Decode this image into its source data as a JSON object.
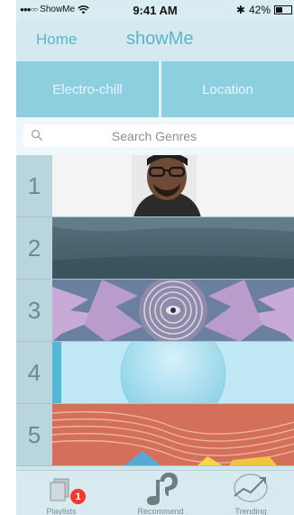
{
  "status_bar": {
    "carrier": "ShowMe",
    "time": "9:41 AM",
    "battery": "42%",
    "battery_level": 0.42
  },
  "nav": {
    "home_label": "Home",
    "title": "showMe"
  },
  "filters": {
    "genre": "Electro-chill",
    "location": "Location"
  },
  "search": {
    "placeholder": "Search Genres"
  },
  "playlist_rows": [
    {
      "rank": "1"
    },
    {
      "rank": "2"
    },
    {
      "rank": "3"
    },
    {
      "rank": "4"
    },
    {
      "rank": "5"
    }
  ],
  "tab_bar": {
    "playlists_label": "Playlists",
    "playlists_badge": "1",
    "recommend_label": "Recommend",
    "trending_label": "Trending"
  },
  "colors": {
    "accent": "#5fb3c9",
    "filter_bg": "#8ecfdf",
    "badge": "#f23b2a"
  }
}
